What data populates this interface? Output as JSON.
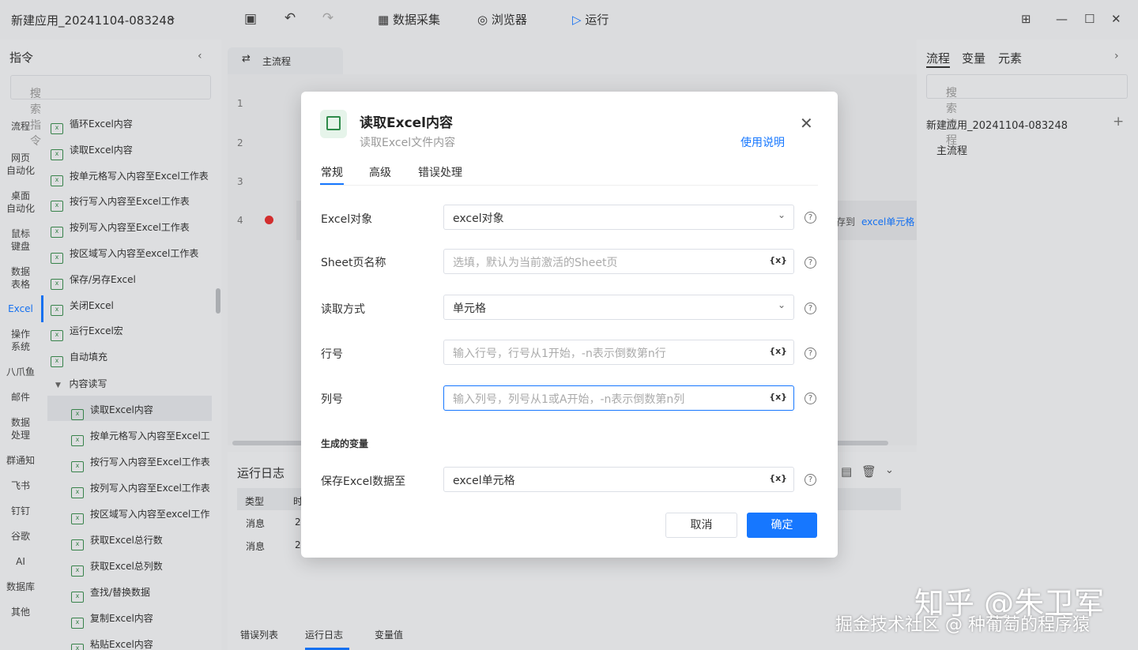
{
  "titlebar": {
    "app_title": "新建应用_20241104-083248",
    "data_collect": "数据采集",
    "browser": "浏览器",
    "run": "运行"
  },
  "left": {
    "header": "指令",
    "search_placeholder": "搜索指令",
    "categories": [
      "流程",
      "网页\n自动化",
      "桌面\n自动化",
      "鼠标\n键盘",
      "数据\n表格",
      "Excel",
      "操作\n系统",
      "八爪鱼",
      "邮件",
      "数据\n处理",
      "群通知",
      "飞书",
      "钉钉",
      "谷歌",
      "AI",
      "数据库",
      "其他"
    ],
    "commands": [
      "循环Excel内容",
      "读取Excel内容",
      "按单元格写入内容至Excel工作表",
      "按行写入内容至Excel工作表",
      "按列写入内容至Excel工作表",
      "按区域写入内容至excel工作表",
      "保存/另存Excel",
      "关闭Excel",
      "运行Excel宏",
      "自动填充"
    ],
    "group": "内容读写",
    "subcommands": [
      "读取Excel内容",
      "按单元格写入内容至Excel工",
      "按行写入内容至Excel工作表",
      "按列写入内容至Excel工作表",
      "按区域写入内容至excel工作",
      "获取Excel总行数",
      "获取Excel总列数",
      "查找/替换数据",
      "复制Excel内容",
      "粘贴Excel内容"
    ]
  },
  "center": {
    "tab": "主流程",
    "line_numbers": [
      "1",
      "2",
      "3",
      "4"
    ],
    "step_text_1": "存到",
    "step_text_2": "excel单元格"
  },
  "log": {
    "title": "运行日志",
    "col_type": "类型",
    "col_time": "时",
    "rows": [
      {
        "type": "消息",
        "time": "2"
      },
      {
        "type": "消息",
        "time": "2"
      }
    ],
    "tabs": [
      "错误列表",
      "运行日志",
      "变量值"
    ]
  },
  "right": {
    "tabs": [
      "流程",
      "变量",
      "元素"
    ],
    "search_placeholder": "搜索流程",
    "app": "新建应用_20241104-083248",
    "flow": "主流程"
  },
  "dialog": {
    "title": "读取Excel内容",
    "subtitle": "读取Excel文件内容",
    "help": "使用说明",
    "tabs": [
      "常规",
      "高级",
      "错误处理"
    ],
    "fields": [
      {
        "label": "Excel对象",
        "value": "excel对象",
        "placeholder": ""
      },
      {
        "label": "Sheet页名称",
        "value": "",
        "placeholder": "选填，默认为当前激活的Sheet页"
      },
      {
        "label": "读取方式",
        "value": "单元格",
        "placeholder": ""
      },
      {
        "label": "行号",
        "value": "",
        "placeholder": "输入行号，行号从1开始，-n表示倒数第n行"
      },
      {
        "label": "列号",
        "value": "",
        "placeholder": "输入列号，列号从1或A开始，-n表示倒数第n列"
      }
    ],
    "generated_vars": "生成的变量",
    "output": {
      "label": "保存Excel数据至",
      "value": "excel单元格"
    },
    "var_symbol": "{x}",
    "cancel": "取消",
    "ok": "确定"
  },
  "watermark": {
    "line1": "知乎 @朱卫军",
    "line2": "掘金技术社区 @ 种葡萄的程序猿"
  }
}
